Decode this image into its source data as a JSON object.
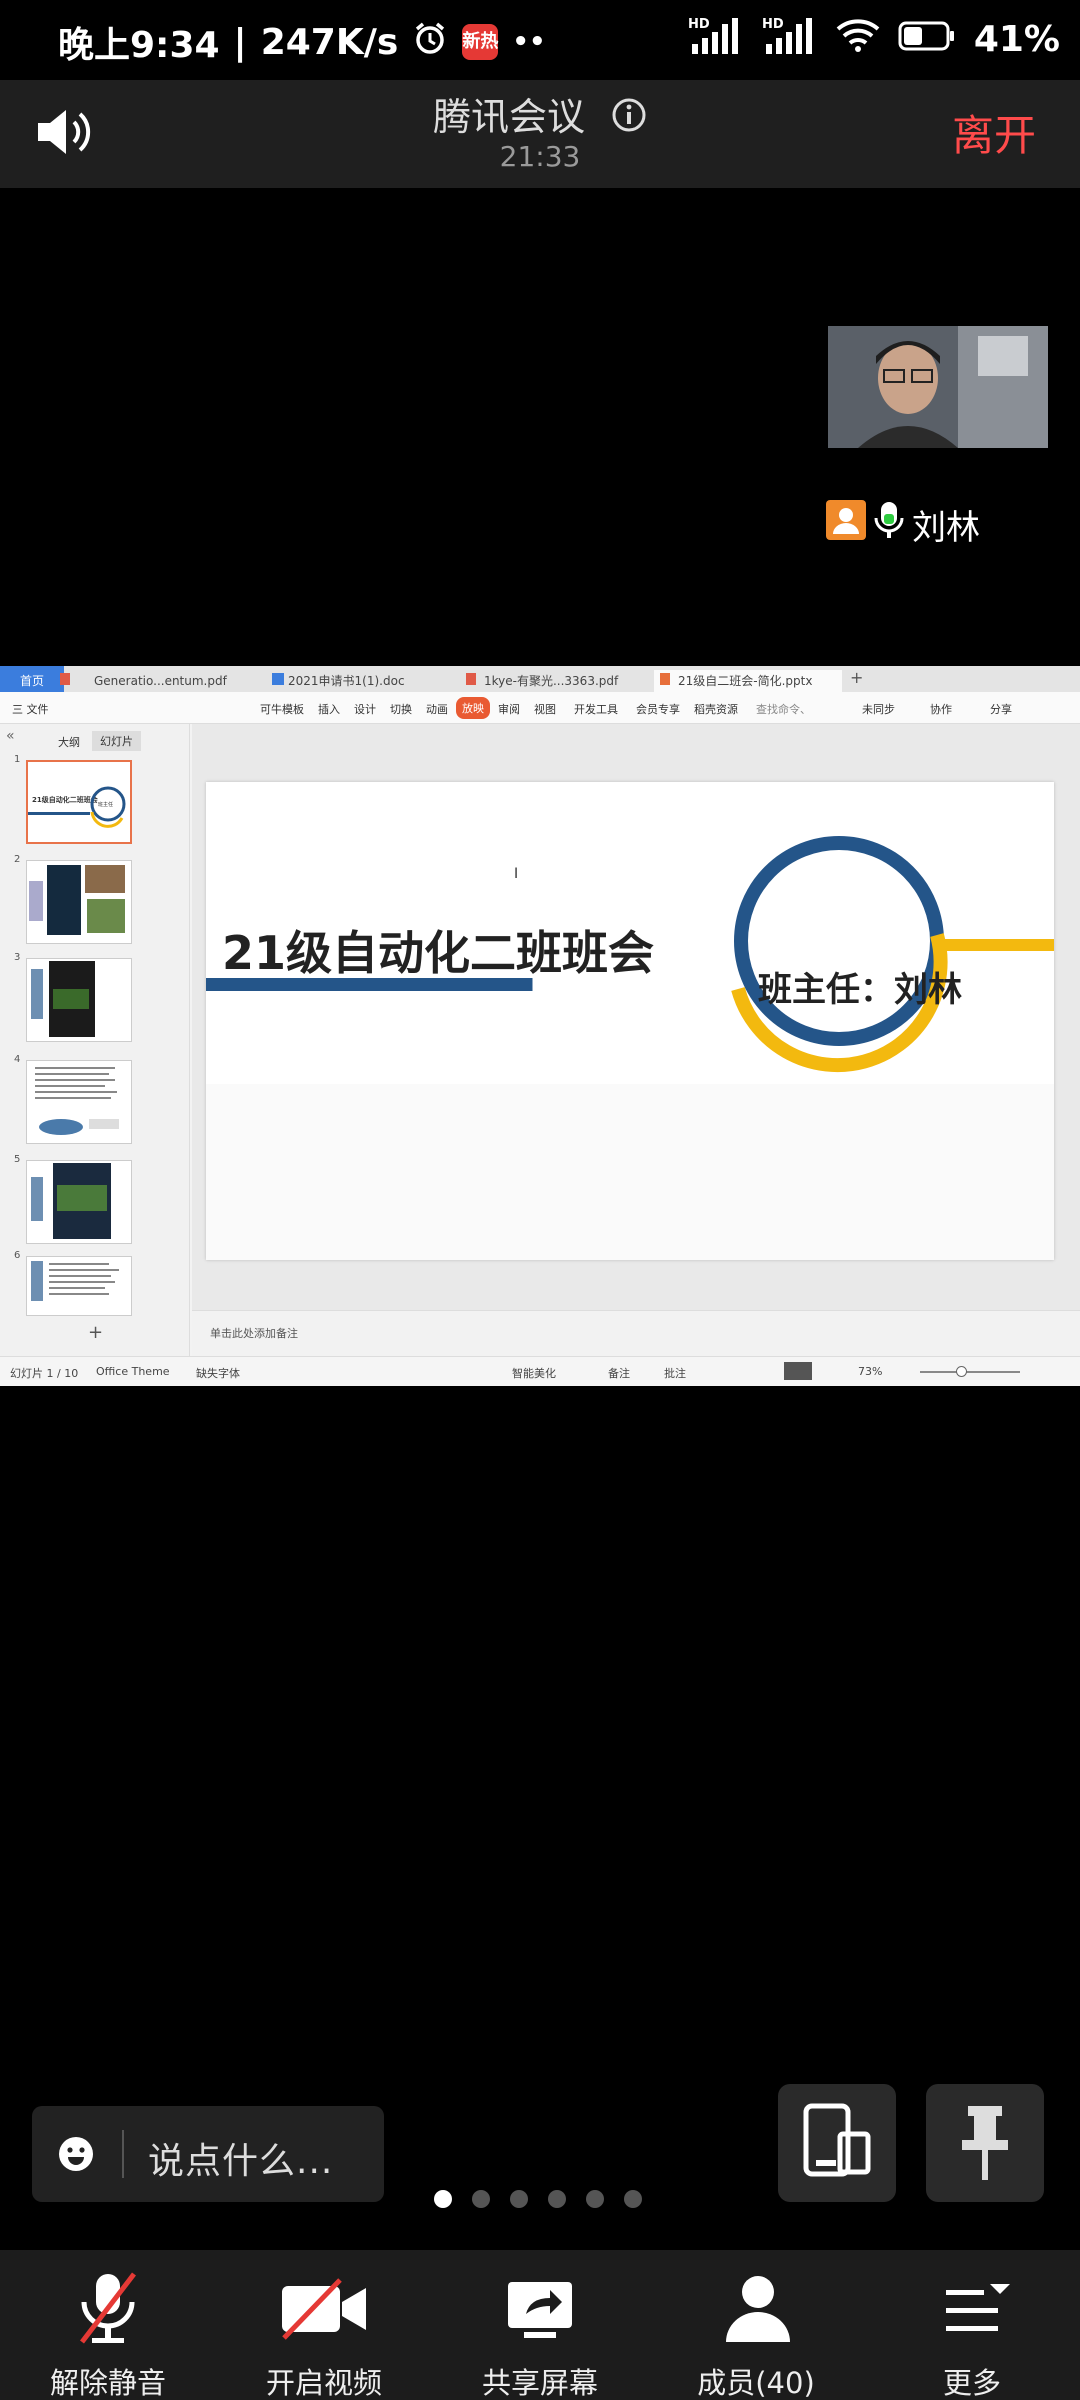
{
  "status_bar": {
    "time": "晚上9:34",
    "speed": "247K/s",
    "news_badge": "新热",
    "more": "••",
    "hd": "HD",
    "battery": "41%"
  },
  "top_bar": {
    "title": "腾讯会议",
    "duration": "21:33",
    "leave_label": "离开"
  },
  "participant": {
    "name": "刘林"
  },
  "shared_screen": {
    "tabs": [
      "首页",
      "Generatio...entum.pdf",
      "2021申请书1(1).doc",
      "1kye-有聚光...3363.pdf",
      "21级自二班会-简化.pptx"
    ],
    "menu": [
      "三 文件",
      "可牛模板",
      "插入",
      "设计",
      "切换",
      "动画",
      "放映",
      "审阅",
      "视图",
      "开发工具",
      "会员专享",
      "稻壳资源",
      "查找命令、",
      "未同步",
      "协作",
      "分享"
    ],
    "panel_tabs": [
      "大纲",
      "幻灯片"
    ],
    "slide_numbers": [
      "1",
      "2",
      "3",
      "4",
      "5",
      "6"
    ],
    "slide_title": "21级自动化二班班会",
    "slide_subtitle": "班主任：刘林",
    "notes_placeholder": "单击此处添加备注",
    "status": {
      "slide_counter": "幻灯片 1 / 10",
      "theme": "Office Theme",
      "missing_font": "缺失字体",
      "beautify": "智能美化",
      "notes": "备注",
      "comments": "批注",
      "zoom": "73%"
    }
  },
  "chat": {
    "placeholder": "说点什么..."
  },
  "pager": {
    "count": 6,
    "active": 0
  },
  "toolbar": {
    "unmute": "解除静音",
    "video": "开启视频",
    "share": "共享屏幕",
    "members": "成员(40)",
    "more": "更多"
  },
  "colors": {
    "leave": "#ff4b4b",
    "slide_blue": "#245589",
    "slide_yellow": "#f3b90f",
    "mute_slash": "#e53935"
  }
}
